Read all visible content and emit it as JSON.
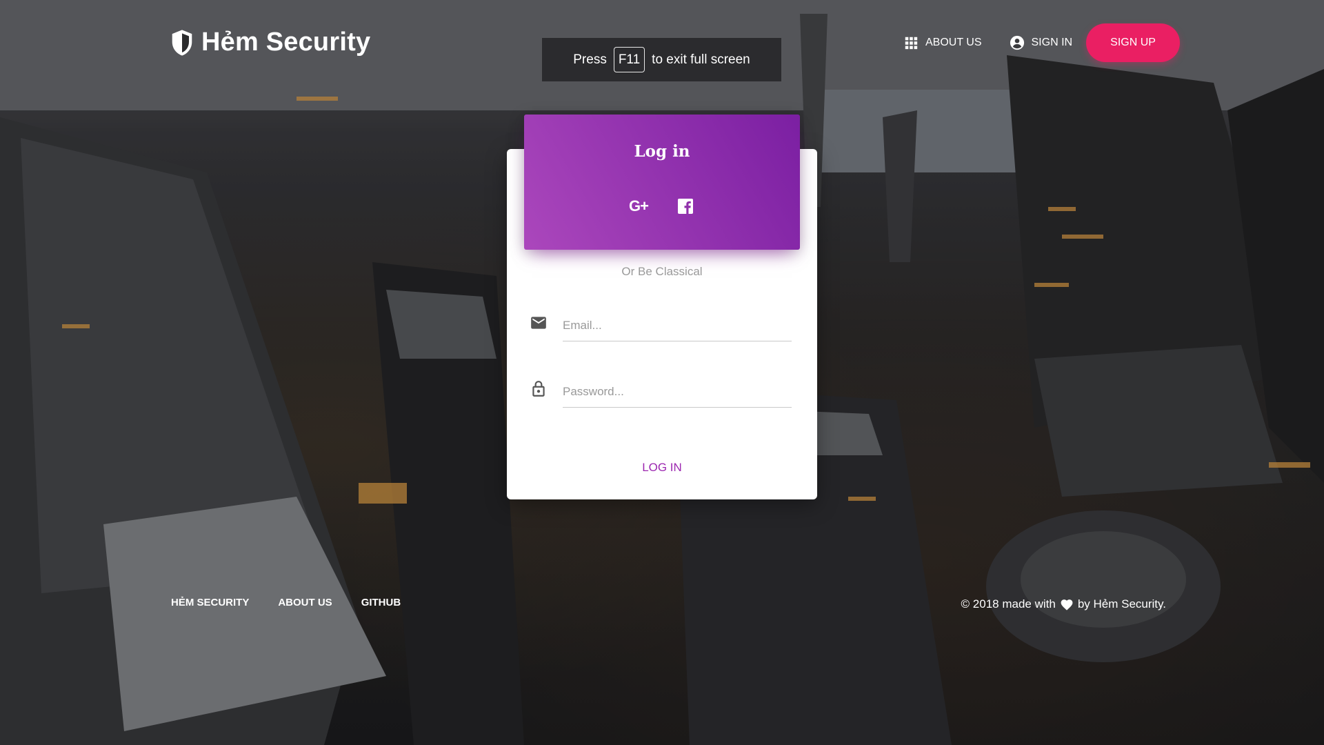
{
  "brand": {
    "name": "Hẻm Security",
    "icon": "shield-icon"
  },
  "fullscreen_banner": {
    "prefix": "Press",
    "key": "F11",
    "suffix": "to exit full screen"
  },
  "nav": {
    "about": {
      "label": "ABOUT US",
      "icon": "apps-grid-icon"
    },
    "signin": {
      "label": "SIGN IN",
      "icon": "account-circle-icon"
    },
    "signup": {
      "label": "SIGN UP"
    }
  },
  "login_card": {
    "title": "Log in",
    "social": [
      {
        "icon": "google-plus-icon",
        "label": "G+"
      },
      {
        "icon": "facebook-icon"
      }
    ],
    "divider": "Or Be Classical",
    "email": {
      "placeholder": "Email...",
      "icon": "mail-icon"
    },
    "password": {
      "placeholder": "Password...",
      "icon": "lock-icon"
    },
    "submit_label": "LOG IN"
  },
  "footer": {
    "links": [
      "HẺM SECURITY",
      "ABOUT US",
      "GITHUB"
    ],
    "copyright_before": "© 2018 made with",
    "copyright_after": "by Hẻm Security.",
    "heart_icon": "heart-icon"
  },
  "colors": {
    "accent_purple": "#9c27b0",
    "signup_pink": "#ea1f63"
  }
}
